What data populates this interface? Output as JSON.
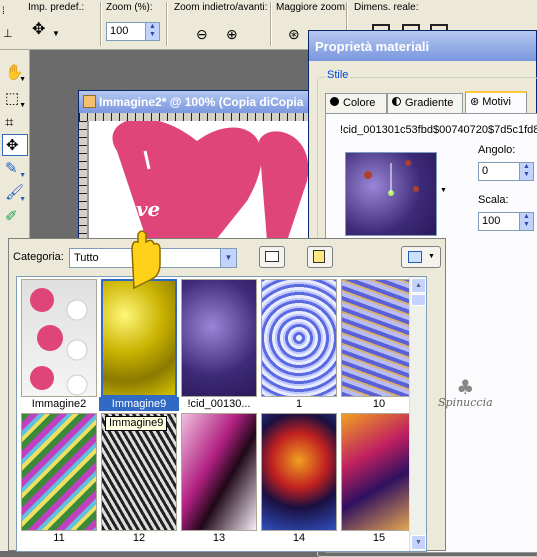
{
  "toolbar": {
    "preset_label": "Imp. predef.:",
    "zoom_label": "Zoom (%):",
    "zoom_value": "100",
    "zoom_nav_label": "Zoom indietro/avanti:",
    "more_zoom_label": "Maggiore zoom:",
    "real_size_label": "Dimens. reale:"
  },
  "image_window": {
    "title": "Immagine2* @ 100% (Copia diCopia"
  },
  "materials": {
    "title": "Proprietà materiali",
    "group_label": "Stile",
    "tabs": [
      {
        "label": "Colore"
      },
      {
        "label": "Gradiente"
      },
      {
        "label": "Motivi"
      }
    ],
    "active_tab": "Motivi",
    "pattern_name": "!cid_001301c53fbd$00740720$7d5c1fd8",
    "angle_label": "Angolo:",
    "angle_value": "0",
    "scale_label": "Scala:",
    "scale_value": "100"
  },
  "browser": {
    "category_label": "Categoria:",
    "category_value": "Tutto",
    "tooltip": "Immagine9",
    "items": [
      {
        "label": "Immagine2"
      },
      {
        "label": "Immagine9"
      },
      {
        "label": "!cid_00130..."
      },
      {
        "label": "1"
      },
      {
        "label": "10"
      },
      {
        "label": "11"
      },
      {
        "label": "12"
      },
      {
        "label": "13"
      },
      {
        "label": "14"
      },
      {
        "label": "15"
      }
    ]
  },
  "watermark": "Spinuccia",
  "canvas_text": "love"
}
